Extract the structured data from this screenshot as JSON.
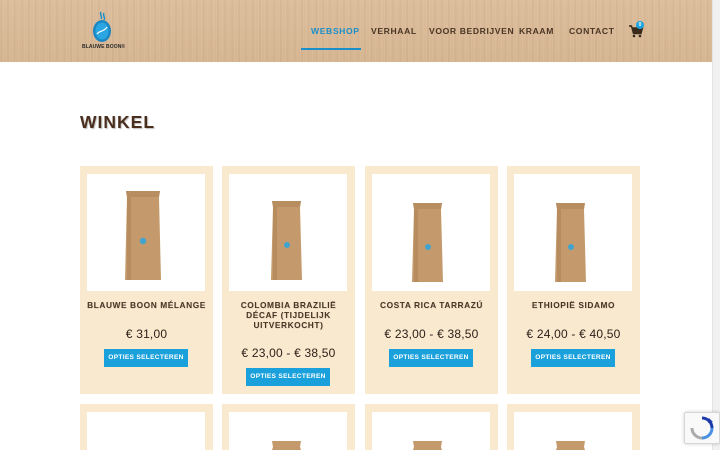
{
  "brand": {
    "name": "BLAUWE BOON®"
  },
  "nav": {
    "items": [
      {
        "label": "WEBSHOP",
        "active": true
      },
      {
        "label": "VERHAAL",
        "active": false
      },
      {
        "label": "VOOR BEDRIJVEN",
        "active": false
      },
      {
        "label": "KRAAM",
        "active": false
      },
      {
        "label": "CONTACT",
        "active": false
      }
    ],
    "cart_count": "0"
  },
  "page": {
    "title": "WINKEL"
  },
  "products": [
    {
      "name": "BLAUWE BOON MÉLANGE",
      "price": "€ 31,00",
      "button": "OPTIES SELECTEREN"
    },
    {
      "name": "COLOMBIA BRAZILIË DÉCAF (TIJDELIJK UITVERKOCHT)",
      "price": "€ 23,00 - € 38,50",
      "button": "OPTIES SELECTEREN"
    },
    {
      "name": "COSTA RICA TARRAZÚ",
      "price": "€ 23,00 - € 38,50",
      "button": "OPTIES SELECTEREN"
    },
    {
      "name": "ETHIOPIË SIDAMO",
      "price": "€ 24,00 - € 40,50",
      "button": "OPTIES SELECTEREN"
    }
  ],
  "colors": {
    "accent": "#1aa0db",
    "card_bg": "#f8e9cf",
    "title": "#4a2e1d"
  },
  "icons": {
    "cart": "shopping-cart-icon",
    "logo": "coffee-bean-logo-icon",
    "recaptcha": "recaptcha-icon"
  }
}
